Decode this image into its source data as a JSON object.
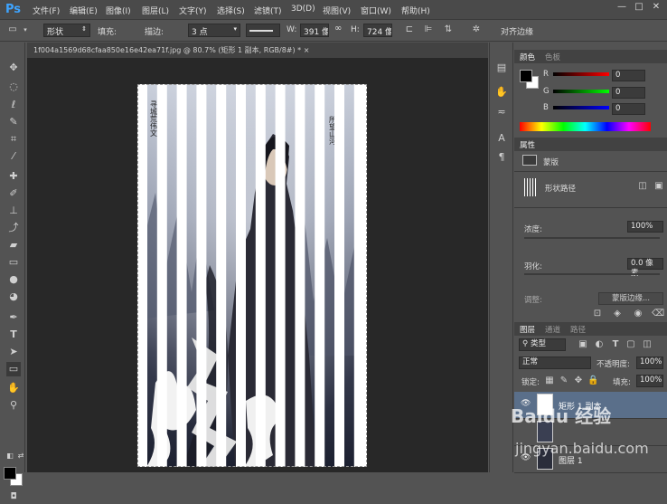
{
  "app": {
    "logo": "Ps",
    "menus": [
      "文件(F)",
      "编辑(E)",
      "图像(I)",
      "图层(L)",
      "文字(Y)",
      "选择(S)",
      "滤镜(T)",
      "3D(D)",
      "视图(V)",
      "窗口(W)",
      "帮助(H)"
    ],
    "window_controls": [
      "—",
      "□",
      "✕"
    ]
  },
  "options_bar": {
    "mode": "形状",
    "fill_label": "填充:",
    "stroke_label": "描边:",
    "stroke_width": "3 点",
    "w_label": "W:",
    "w_value": "391 像",
    "link_icon": "∞",
    "h_label": "H:",
    "h_value": "724 像",
    "align_edges": "对齐边缘"
  },
  "document": {
    "tab_title": "1f004a1569d68cfaa850e16e42ea71f.jpg @ 80.7% (矩形 1 副本, RGB/8#) *",
    "close": "×",
    "poster_text_left": "寻城荒伟文",
    "poster_text_right": "所望山河"
  },
  "color_panel": {
    "tabs": [
      "颜色",
      "色板"
    ],
    "r_label": "R",
    "r_value": "0",
    "g_label": "G",
    "g_value": "0",
    "b_label": "B",
    "b_value": "0"
  },
  "properties_panel": {
    "tab": "属性",
    "type_label": "蒙版",
    "path_label": "形状路径",
    "density_label": "浓度:",
    "density_value": "100%",
    "feather_label": "羽化:",
    "feather_value": "0.0 像素",
    "adjust_label": "调整:",
    "mask_edge_button": "蒙版边缘..."
  },
  "layers_panel": {
    "tabs": [
      "图层",
      "通道",
      "路径"
    ],
    "filter": "类型",
    "blend_mode": "正常",
    "opacity_label": "不透明度:",
    "opacity_value": "100%",
    "lock_label": "锁定:",
    "fill_label": "填充:",
    "fill_value": "100%",
    "layers": [
      {
        "name": "矩形 1 副本",
        "selected": true
      },
      {
        "name": "图层 1",
        "selected": false
      }
    ]
  },
  "watermark": {
    "brand": "Baidu 经验",
    "url": "jingyan.baidu.com"
  },
  "colors": {
    "accent": "#3ea4ff",
    "selected_layer": "#5a6f8a",
    "panel_bg": "#535353",
    "workspace": "#282828"
  }
}
